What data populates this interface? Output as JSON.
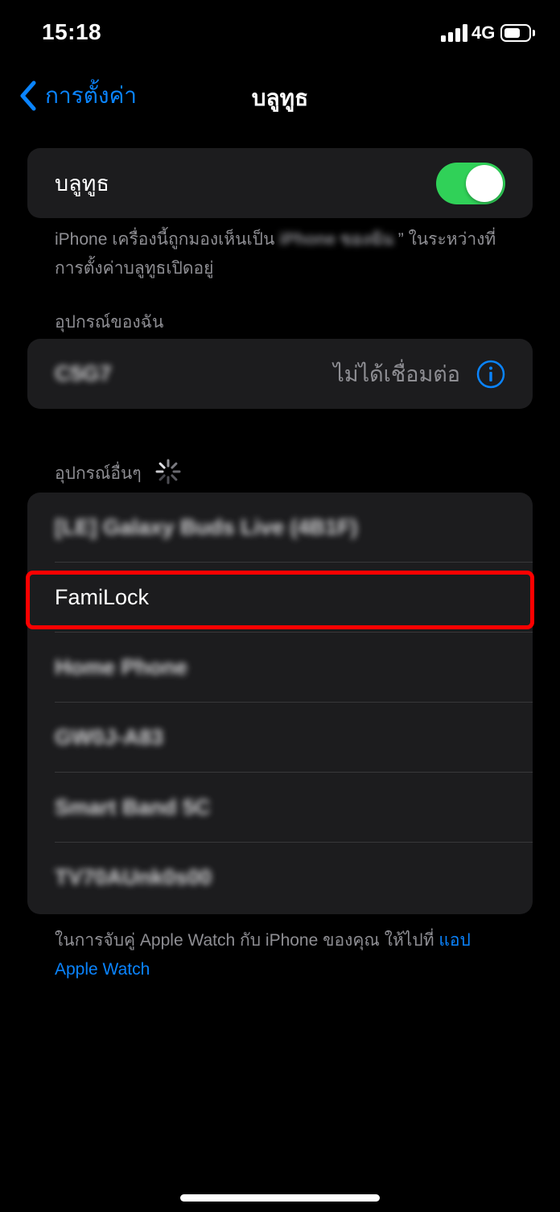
{
  "status_bar": {
    "time": "15:18",
    "network": "4G",
    "battery_icon": "battery-icon",
    "signal_icon": "signal-bars-icon"
  },
  "nav": {
    "back_label": "การตั้งค่า",
    "title": "บลูทูธ"
  },
  "bluetooth": {
    "label": "บลูทูธ",
    "enabled": true,
    "toggle_color": "#30d158",
    "visibility_prefix": "iPhone เครื่องนี้ถูกมองเห็นเป็น",
    "visibility_name_blurred": "iPhone ของฉัน",
    "visibility_suffix": "” ในระหว่างที่",
    "visibility_line2": "การตั้งค่าบลูทูธเปิดอยู่"
  },
  "my_devices": {
    "header": "อุปกรณ์ของฉัน",
    "items": [
      {
        "name_blurred": "C5G7",
        "status": "ไม่ได้เชื่อมต่อ",
        "icon": "info-icon"
      }
    ]
  },
  "other_devices": {
    "header": "อุปกรณ์อื่นๆ",
    "loading_icon": "loading-spinner-icon",
    "items": [
      {
        "name": "[LE] Galaxy Buds Live (4B1F)",
        "blurred": true
      },
      {
        "name": "FamiLock",
        "blurred": false
      },
      {
        "name": "Home Phone",
        "blurred": true
      },
      {
        "name": "GW0J-A83",
        "blurred": true
      },
      {
        "name": "Smart Band 5C",
        "blurred": true
      },
      {
        "name": "TV70AUnk0s00",
        "blurred": true
      }
    ]
  },
  "footer": {
    "text": "ในการจับคู่ Apple Watch กับ iPhone ของคุณ ให้ไปที่",
    "link": "แอป Apple Watch"
  },
  "colors": {
    "accent": "#0a84ff",
    "highlight": "#ff0000",
    "card": "#1c1c1e",
    "secondary_text": "#8e8e93"
  }
}
